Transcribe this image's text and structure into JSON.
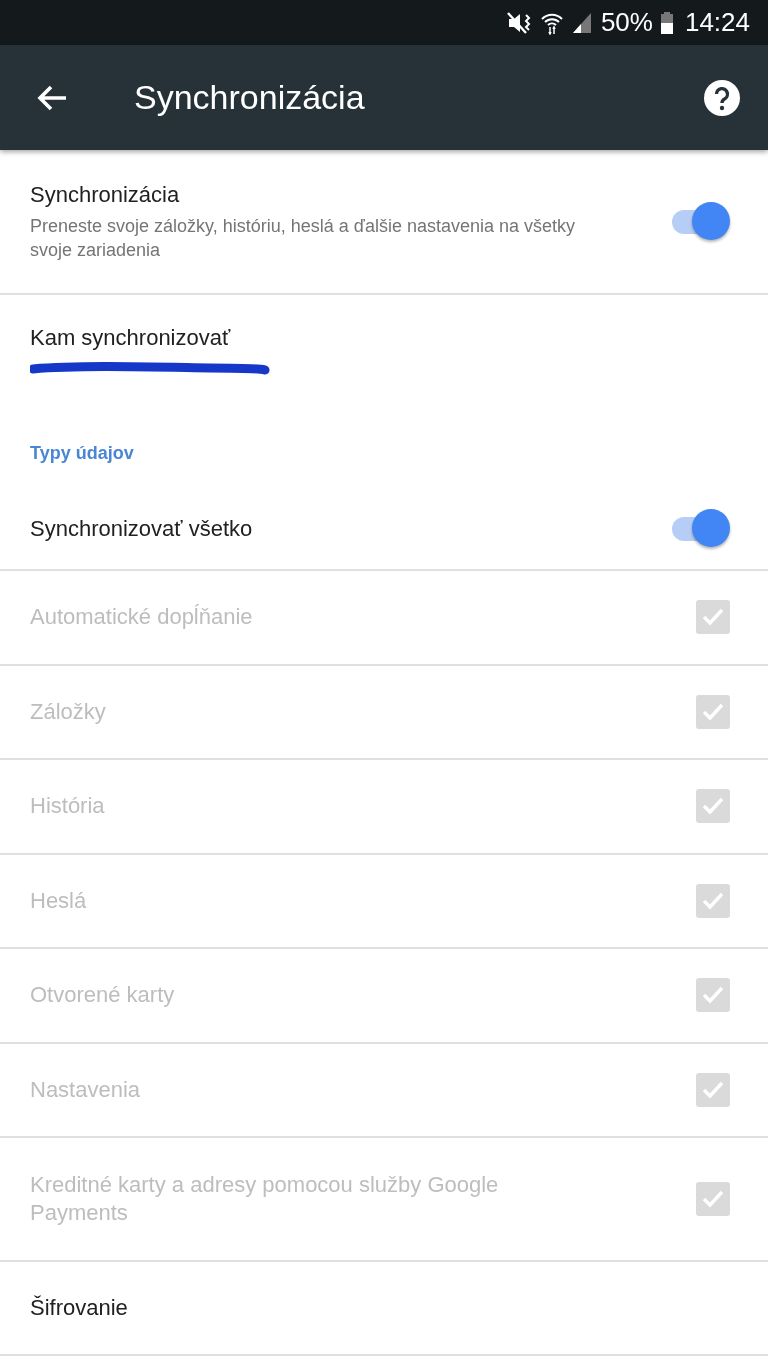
{
  "status_bar": {
    "battery": "50%",
    "time": "14:24"
  },
  "toolbar": {
    "title": "Synchronizácia"
  },
  "sync": {
    "title": "Synchronizácia",
    "summary": "Preneste svoje záložky, históriu, heslá a ďalšie nastavenia na všetky svoje zariadenia",
    "on": true
  },
  "account": {
    "title": "Kam synchronizovať",
    "email_redacted": true
  },
  "section_header": "Typy údajov",
  "sync_all": {
    "label": "Synchronizovať všetko",
    "on": true
  },
  "data_types": [
    {
      "label": "Automatické dopĺňanie",
      "checked": true,
      "disabled": true
    },
    {
      "label": "Záložky",
      "checked": true,
      "disabled": true
    },
    {
      "label": "História",
      "checked": true,
      "disabled": true
    },
    {
      "label": "Heslá",
      "checked": true,
      "disabled": true
    },
    {
      "label": "Otvorené karty",
      "checked": true,
      "disabled": true
    },
    {
      "label": "Nastavenia",
      "checked": true,
      "disabled": true
    },
    {
      "label": "Kreditné karty a adresy pomocou služby Google Payments",
      "checked": true,
      "disabled": true
    }
  ],
  "encryption": {
    "label": "Šifrovanie"
  }
}
